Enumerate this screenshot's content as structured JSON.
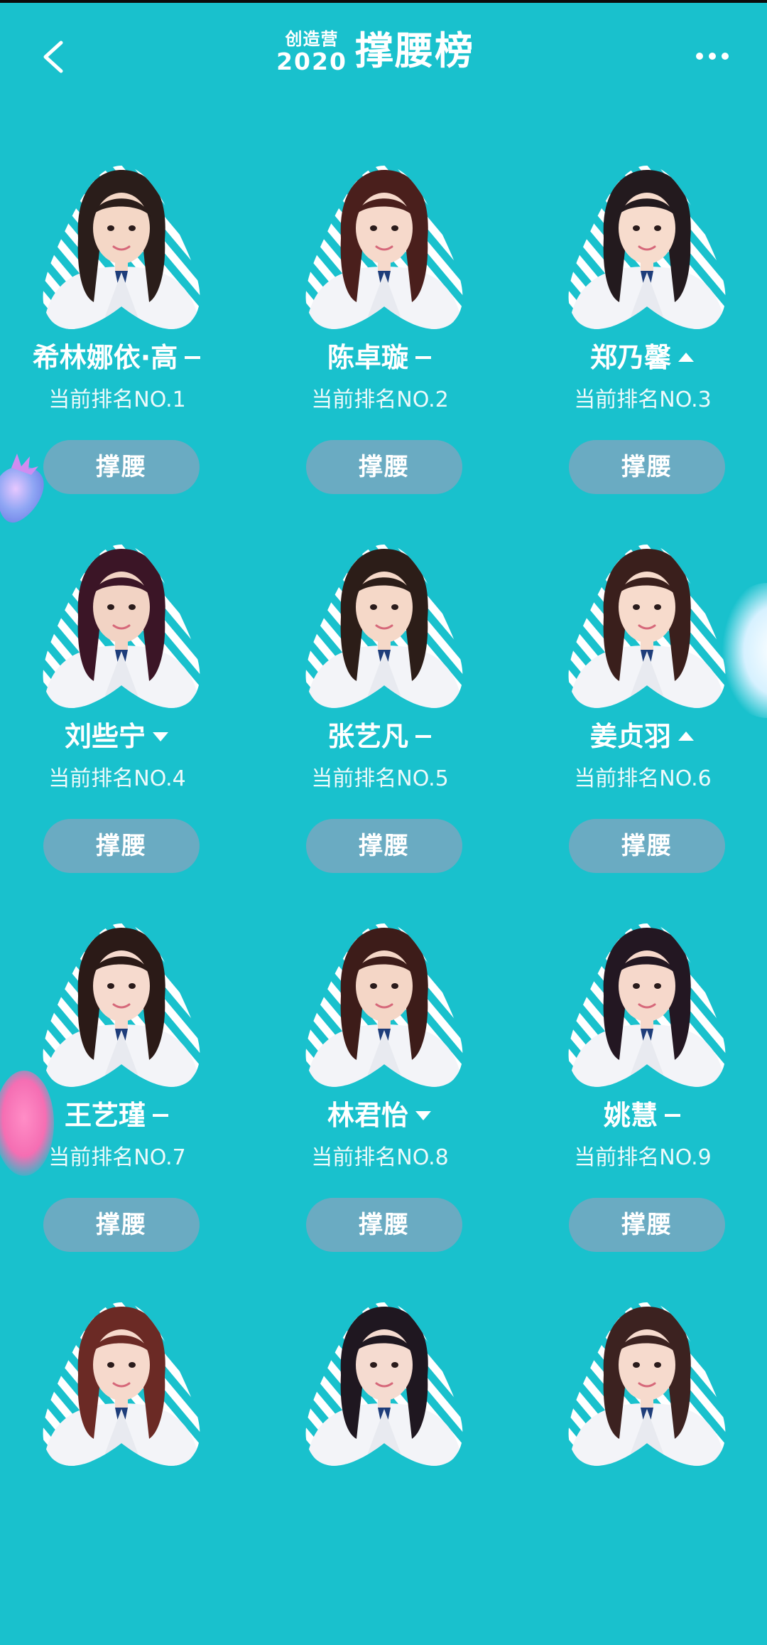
{
  "header": {
    "logo_small": "创造营",
    "logo_year": "2020",
    "title": "撑腰榜"
  },
  "notice": {
    "left_text": "",
    "right_text": ""
  },
  "colors": {
    "background": "#19c1cd",
    "button": "#6aabc2",
    "stripe": "#19c1cd",
    "text": "#ffffff"
  },
  "icons": {
    "back": "chevron-left-icon",
    "more": "more-dots-icon",
    "trend_up": "triangle-up-icon",
    "trend_down": "triangle-down-icon",
    "trend_flat": "dash-icon"
  },
  "contestants": [
    {
      "name": "希林娜依·高",
      "trend": "flat",
      "rank_label": "当前排名NO.1",
      "button_label": "撑腰"
    },
    {
      "name": "陈卓璇",
      "trend": "flat",
      "rank_label": "当前排名NO.2",
      "button_label": "撑腰"
    },
    {
      "name": "郑乃馨",
      "trend": "up",
      "rank_label": "当前排名NO.3",
      "button_label": "撑腰"
    },
    {
      "name": "刘些宁",
      "trend": "down",
      "rank_label": "当前排名NO.4",
      "button_label": "撑腰"
    },
    {
      "name": "张艺凡",
      "trend": "flat",
      "rank_label": "当前排名NO.5",
      "button_label": "撑腰"
    },
    {
      "name": "姜贞羽",
      "trend": "up",
      "rank_label": "当前排名NO.6",
      "button_label": "撑腰"
    },
    {
      "name": "王艺瑾",
      "trend": "flat",
      "rank_label": "当前排名NO.7",
      "button_label": "撑腰"
    },
    {
      "name": "林君怡",
      "trend": "down",
      "rank_label": "当前排名NO.8",
      "button_label": "撑腰"
    },
    {
      "name": "姚慧",
      "trend": "flat",
      "rank_label": "当前排名NO.9",
      "button_label": "撑腰"
    },
    {
      "name": "",
      "trend": "",
      "rank_label": "",
      "button_label": ""
    },
    {
      "name": "",
      "trend": "",
      "rank_label": "",
      "button_label": ""
    },
    {
      "name": "",
      "trend": "",
      "rank_label": "",
      "button_label": ""
    }
  ]
}
